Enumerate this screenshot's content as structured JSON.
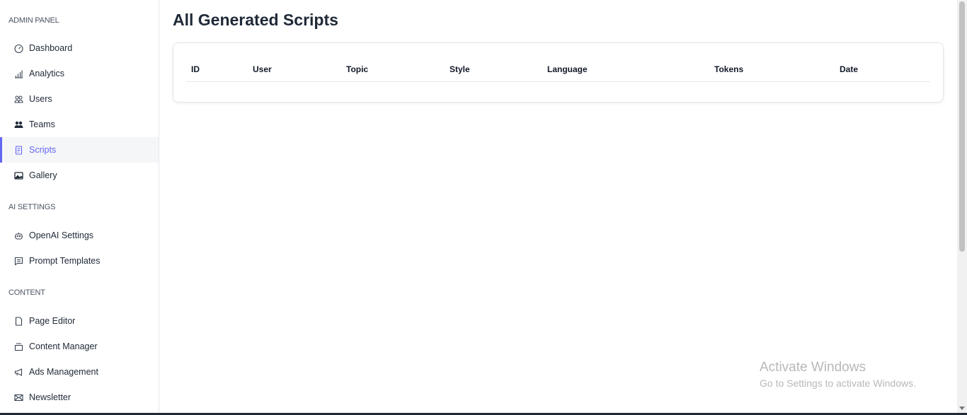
{
  "sidebar": {
    "sections": [
      {
        "title": "ADMIN PANEL",
        "items": [
          {
            "label": "Dashboard",
            "icon": "gauge-icon"
          },
          {
            "label": "Analytics",
            "icon": "bar-chart-icon"
          },
          {
            "label": "Users",
            "icon": "users-icon"
          },
          {
            "label": "Teams",
            "icon": "team-icon"
          },
          {
            "label": "Scripts",
            "icon": "document-icon",
            "active": true
          },
          {
            "label": "Gallery",
            "icon": "image-icon"
          }
        ]
      },
      {
        "title": "AI SETTINGS",
        "items": [
          {
            "label": "OpenAI Settings",
            "icon": "robot-icon"
          },
          {
            "label": "Prompt Templates",
            "icon": "message-icon"
          }
        ]
      },
      {
        "title": "CONTENT",
        "items": [
          {
            "label": "Page Editor",
            "icon": "file-icon"
          },
          {
            "label": "Content Manager",
            "icon": "archive-icon"
          },
          {
            "label": "Ads Management",
            "icon": "megaphone-icon"
          },
          {
            "label": "Newsletter",
            "icon": "mail-icon"
          }
        ]
      }
    ]
  },
  "main": {
    "title": "All Generated Scripts",
    "table": {
      "columns": [
        "ID",
        "User",
        "Topic",
        "Style",
        "Language",
        "Tokens",
        "Date"
      ],
      "rows": []
    }
  },
  "watermark": {
    "line1": "Activate Windows",
    "line2": "Go to Settings to activate Windows."
  },
  "colors": {
    "accent": "#6366f1"
  }
}
